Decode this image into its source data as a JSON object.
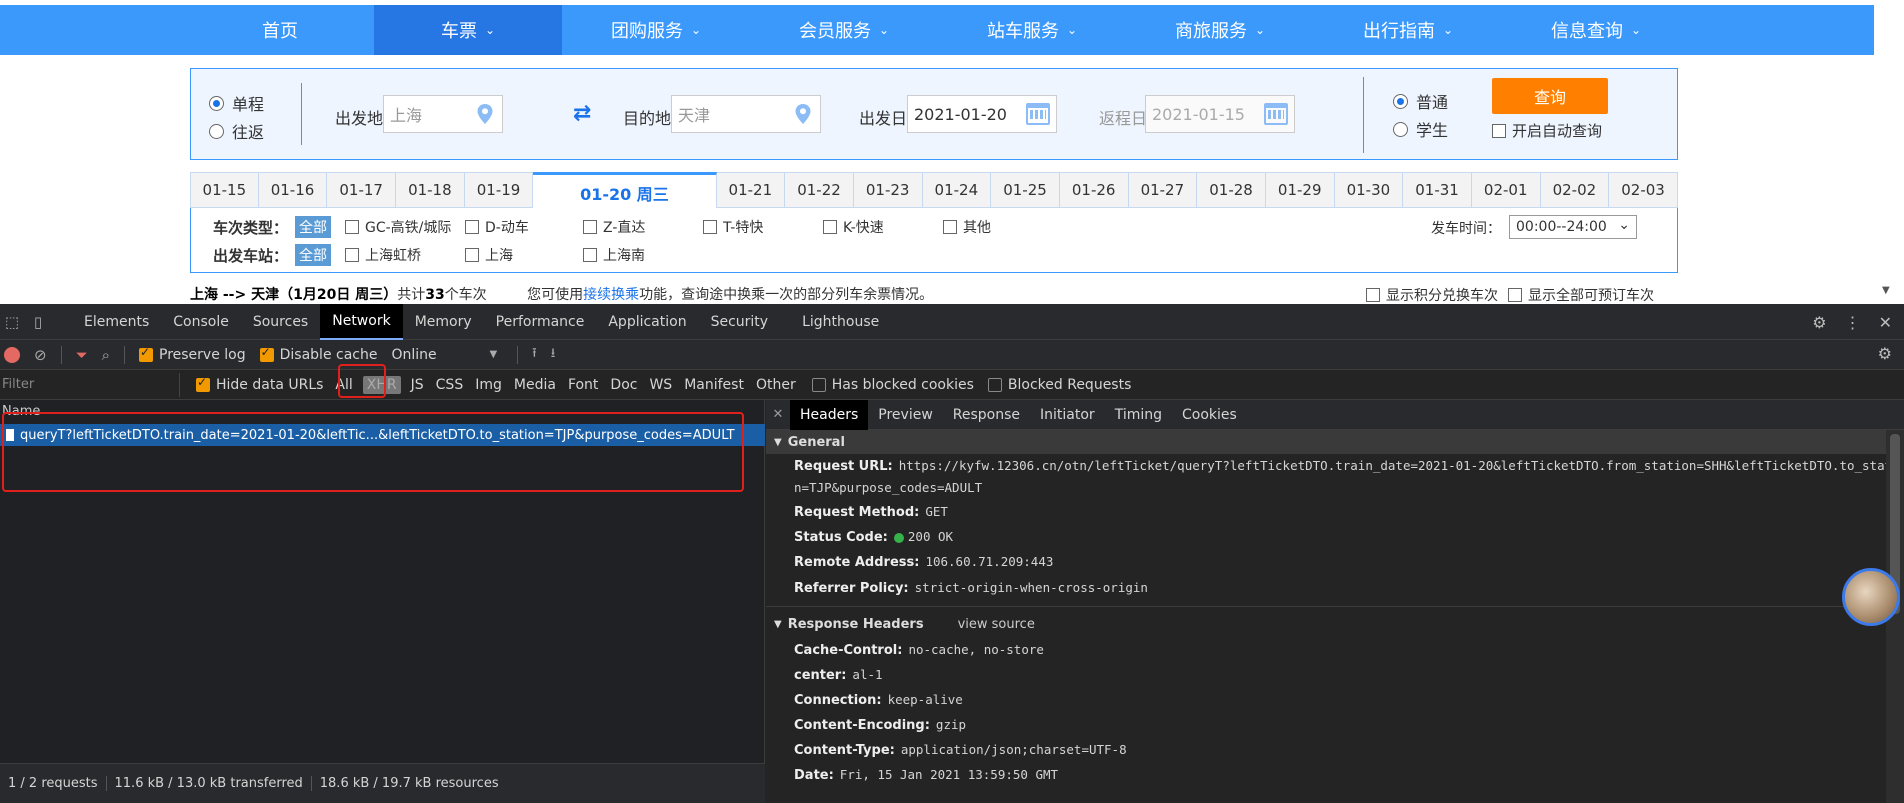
{
  "nav": {
    "items": [
      {
        "label": "首页",
        "chevron": ""
      },
      {
        "label": "车票",
        "chevron": "⌄"
      },
      {
        "label": "团购服务",
        "chevron": "⌄"
      },
      {
        "label": "会员服务",
        "chevron": "⌄"
      },
      {
        "label": "站车服务",
        "chevron": "⌄"
      },
      {
        "label": "商旅服务",
        "chevron": "⌄"
      },
      {
        "label": "出行指南",
        "chevron": "⌄"
      },
      {
        "label": "信息查询",
        "chevron": "⌄"
      }
    ],
    "active_index": 1
  },
  "search": {
    "trip_oneway": "单程",
    "trip_round": "往返",
    "from_label": "出发地",
    "from_value": "上海",
    "to_label": "目的地",
    "to_value": "天津",
    "depart_label": "出发日",
    "depart_value": "2021-01-20",
    "return_label": "返程日",
    "return_value": "2021-01-15",
    "type_normal": "普通",
    "type_student": "学生",
    "query_label": "查询",
    "auto_query_label": "开启自动查询"
  },
  "dates": {
    "before": [
      "01-15",
      "01-16",
      "01-17",
      "01-18",
      "01-19"
    ],
    "active": "01-20 周三",
    "after": [
      "01-21",
      "01-22",
      "01-23",
      "01-24",
      "01-25",
      "01-26",
      "01-27",
      "01-28",
      "01-29",
      "01-30",
      "01-31",
      "02-01",
      "02-02",
      "02-03"
    ]
  },
  "filters": {
    "train_type_label": "车次类型：",
    "all_label": "全部",
    "train_types": [
      "GC-高铁/城际",
      "D-动车",
      "Z-直达",
      "T-特快",
      "K-快速",
      "其他"
    ],
    "station_label": "出发车站：",
    "stations": [
      "上海虹桥",
      "上海",
      "上海南"
    ],
    "time_label": "发车时间：",
    "time_value": "00:00--24:00"
  },
  "summary": {
    "route": "上海 --> 天津（1月20日  周三）",
    "count_prefix": "共计",
    "count": "33",
    "count_suffix": "个车次",
    "hint_prefix": "您可使用",
    "hint_link": "接续换乘",
    "hint_suffix": "功能，查询途中换乘一次的部分列车余票情况。",
    "points_label": "显示积分兑换车次",
    "bookable_label": "显示全部可预订车次"
  },
  "devtools": {
    "tabs": [
      "Elements",
      "Console",
      "Sources",
      "Network",
      "Memory",
      "Performance",
      "Application",
      "Security",
      "Lighthouse"
    ],
    "active_tab": "Network",
    "preserve_log": "Preserve log",
    "disable_cache": "Disable cache",
    "throttle": "Online",
    "filter_placeholder": "Filter",
    "hide_data_urls": "Hide data URLs",
    "types": [
      "All",
      "XHR",
      "JS",
      "CSS",
      "Img",
      "Media",
      "Font",
      "Doc",
      "WS",
      "Manifest",
      "Other"
    ],
    "has_blocked": "Has blocked cookies",
    "blocked_requests": "Blocked Requests",
    "name_col": "Name",
    "request_name": "queryT?leftTicketDTO.train_date=2021-01-20&leftTic...&leftTicketDTO.to_station=TJP&purpose_codes=ADULT",
    "status_requests": "1 / 2 requests",
    "status_transferred": "11.6 kB / 13.0 kB transferred",
    "status_resources": "18.6 kB / 19.7 kB resources",
    "detail_tabs": [
      "Headers",
      "Preview",
      "Response",
      "Initiator",
      "Timing",
      "Cookies"
    ],
    "general_title": "General",
    "request_url_key": "Request URL:",
    "request_url_val_1": "https://kyfw.12306.cn/otn/leftTicket/queryT?leftTicketDTO.train_date=2021-01-20&leftTicketDTO.from_station=SHH&leftTicketDTO.to_statio",
    "request_url_val_2": "n=TJP&purpose_codes=ADULT",
    "method_key": "Request Method:",
    "method_val": "GET",
    "status_key": "Status Code:",
    "status_val": "200 OK",
    "remote_key": "Remote Address:",
    "remote_val": "106.60.71.209:443",
    "referrer_key": "Referrer Policy:",
    "referrer_val": "strict-origin-when-cross-origin",
    "response_title": "Response Headers",
    "view_source": "view source",
    "cache_key": "Cache-Control:",
    "cache_val": "no-cache, no-store",
    "center_key": "center:",
    "center_val": "al-1",
    "conn_key": "Connection:",
    "conn_val": "keep-alive",
    "enc_key": "Content-Encoding:",
    "enc_val": "gzip",
    "ctype_key": "Content-Type:",
    "ctype_val": "application/json;charset=UTF-8",
    "date_key": "Date:",
    "date_val": "Fri, 15 Jan 2021 13:59:50 GMT"
  }
}
